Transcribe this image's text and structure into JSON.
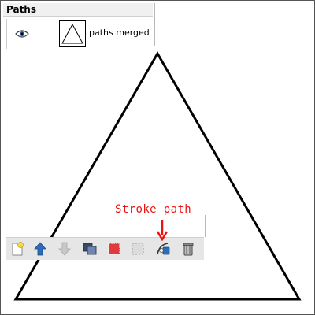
{
  "panel": {
    "title": "Paths",
    "layer": {
      "name": "paths merged",
      "visible": true,
      "icon": "eye-icon"
    }
  },
  "toolbar": {
    "buttons": [
      {
        "name": "new-path",
        "icon": "new-path-icon"
      },
      {
        "name": "raise-path",
        "icon": "arrow-up-icon"
      },
      {
        "name": "lower-path",
        "icon": "arrow-down-icon"
      },
      {
        "name": "duplicate-path",
        "icon": "duplicate-icon"
      },
      {
        "name": "path-to-selection",
        "icon": "path-to-selection-icon"
      },
      {
        "name": "selection-to-path",
        "icon": "selection-to-path-icon"
      },
      {
        "name": "stroke-path",
        "icon": "stroke-path-icon"
      },
      {
        "name": "delete-path",
        "icon": "trash-icon"
      }
    ]
  },
  "annotation": {
    "text": "Stroke path",
    "color": "#ee1111"
  },
  "colors": {
    "stroke": "#000000",
    "toolbar_bg": "#e6e6e6",
    "accent": "#2d6db5"
  }
}
